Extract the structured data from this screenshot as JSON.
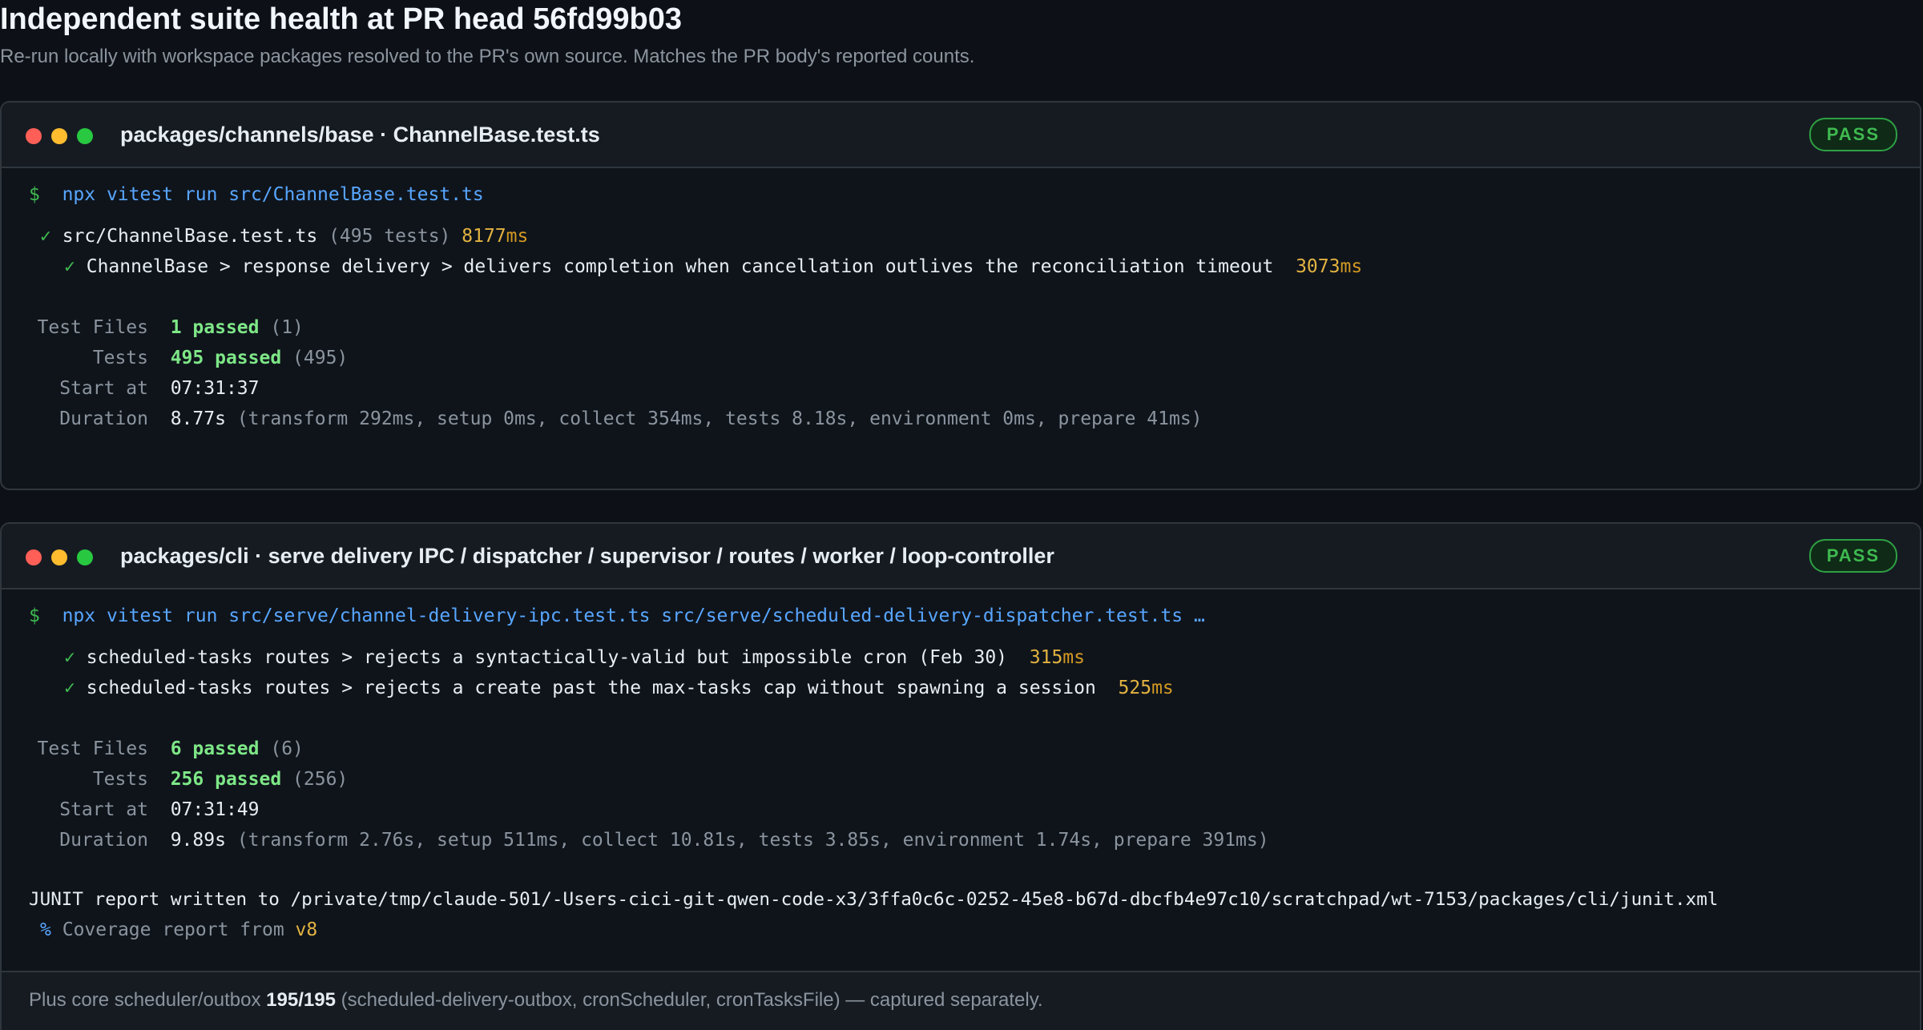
{
  "page": {
    "title": "Independent suite health at PR head 56fd99b03",
    "subtitle": "Re-run locally with workspace packages resolved to the PR's own source. Matches the PR body's reported counts."
  },
  "panels": [
    {
      "title": "packages/channels/base · ChannelBase.test.ts",
      "badge": "PASS",
      "prompt": "$",
      "command": "npx vitest run src/ChannelBase.test.ts",
      "file_check": "✓",
      "file_name": "src/ChannelBase.test.ts",
      "file_count": "(495 tests)",
      "file_time_value": "8177",
      "file_time_unit": "ms",
      "slow_tests": [
        {
          "check": "✓",
          "name": "ChannelBase > response delivery > delivers completion when cancellation outlives the reconciliation timeout",
          "time_value": "3073",
          "time_unit": "ms"
        }
      ],
      "summary": {
        "test_files_label": "Test Files",
        "test_files_passed": "1 passed",
        "test_files_total": "(1)",
        "tests_label": "Tests",
        "tests_passed": "495 passed",
        "tests_total": "(495)",
        "start_label": "Start at",
        "start_value": "07:31:37",
        "duration_label": "Duration",
        "duration_value": "8.77s",
        "duration_detail": "(transform 292ms, setup 0ms, collect 354ms, tests 8.18s, environment 0ms, prepare 41ms)"
      }
    },
    {
      "title": "packages/cli · serve delivery IPC / dispatcher / supervisor / routes / worker / loop-controller",
      "badge": "PASS",
      "prompt": "$",
      "command": "npx vitest run src/serve/channel-delivery-ipc.test.ts src/serve/scheduled-delivery-dispatcher.test.ts …",
      "slow_tests": [
        {
          "check": "✓",
          "name": "scheduled-tasks routes > rejects a syntactically-valid but impossible cron (Feb 30)",
          "time_value": "315",
          "time_unit": "ms"
        },
        {
          "check": "✓",
          "name": "scheduled-tasks routes > rejects a create past the max-tasks cap without spawning a session",
          "time_value": "525",
          "time_unit": "ms"
        }
      ],
      "summary": {
        "test_files_label": "Test Files",
        "test_files_passed": "6 passed",
        "test_files_total": "(6)",
        "tests_label": "Tests",
        "tests_passed": "256 passed",
        "tests_total": "(256)",
        "start_label": "Start at",
        "start_value": "07:31:49",
        "duration_label": "Duration",
        "duration_value": "9.89s",
        "duration_detail": "(transform 2.76s, setup 511ms, collect 10.81s, tests 3.85s, environment 1.74s, prepare 391ms)"
      },
      "junit_line": "JUNIT report written to /private/tmp/claude-501/-Users-cici-git-qwen-code-x3/3ffa0c6c-0252-45e8-b67d-dbcfb4e97c10/scratchpad/wt-7153/packages/cli/junit.xml",
      "coverage_symbol": "%",
      "coverage_text": "Coverage report from",
      "coverage_provider": "v8",
      "footer_prefix": "Plus core scheduler/outbox",
      "footer_count": "195/195",
      "footer_suffix": "(scheduled-delivery-outbox, cronScheduler, cronTasksFile) — captured separately."
    }
  ]
}
